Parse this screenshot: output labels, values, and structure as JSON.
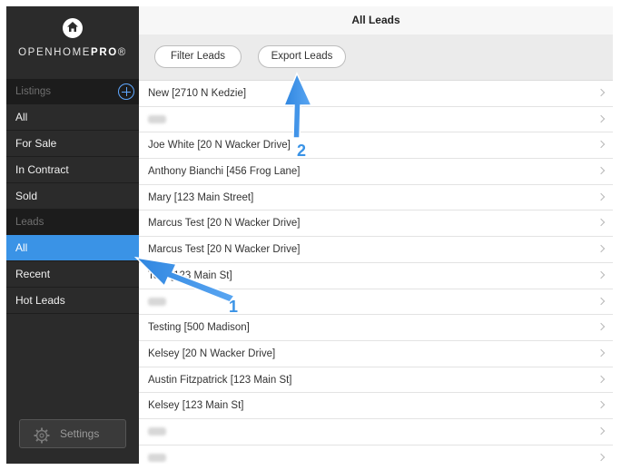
{
  "sidebar": {
    "brand_light": "OPENHOME",
    "brand_bold": "PRO",
    "brand_mark": "®",
    "listings_header": "Listings",
    "listings": [
      "All",
      "For Sale",
      "In Contract",
      "Sold"
    ],
    "leads_header": "Leads",
    "leads": [
      "All",
      "Recent",
      "Hot Leads"
    ],
    "active_lead": 0,
    "settings_label": "Settings"
  },
  "main": {
    "title": "All Leads",
    "filter_label": "Filter Leads",
    "export_label": "Export Leads",
    "rows": [
      {
        "text": "New [2710 N Kedzie]"
      },
      {
        "text": "",
        "blurred": true
      },
      {
        "text": "Joe White [20 N Wacker Drive]"
      },
      {
        "text": "Anthony Bianchi [456 Frog Lane]"
      },
      {
        "text": "Mary [123 Main Street]"
      },
      {
        "text": "Marcus Test [20 N Wacker Drive]"
      },
      {
        "text": "Marcus Test [20 N Wacker Drive]"
      },
      {
        "text": "Te... [123 Main St]"
      },
      {
        "text": "",
        "blurred": true
      },
      {
        "text": "Testing [500 Madison]"
      },
      {
        "text": "Kelsey [20 N Wacker Drive]"
      },
      {
        "text": "Austin Fitzpatrick [123 Main St]"
      },
      {
        "text": "Kelsey [123 Main St]"
      },
      {
        "text": "",
        "blurred": true
      },
      {
        "text": "",
        "blurred": true
      }
    ]
  },
  "annotations": {
    "label_1": "1",
    "label_2": "2",
    "color": "#3a93e6"
  }
}
